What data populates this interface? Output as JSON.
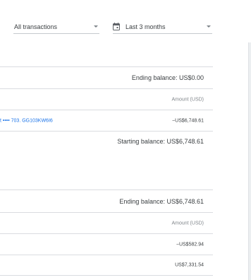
{
  "filters": {
    "transaction_type": "All transactions",
    "period": "Last 3 months",
    "transaction_type_icon": "chevron-down-icon",
    "period_icon": "calendar-icon"
  },
  "section1": {
    "ending_balance": "Ending balance: US$0.00",
    "amount_header": "Amount (USD)",
    "transaction_link": "t •••• 703. GG103KW6I6",
    "transaction_amount": "−US$6,748.61",
    "starting_balance": "Starting balance: US$6,748.61"
  },
  "section2": {
    "ending_balance": "Ending balance: US$6,748.61",
    "amount_header": "Amount (USD)",
    "row1_amount": "−US$582.94",
    "row2_amount": "US$7,331.54"
  },
  "colors": {
    "link": "#1a73e8",
    "text": "#3c4043",
    "muted": "#80868b",
    "divider": "#dadce0"
  }
}
